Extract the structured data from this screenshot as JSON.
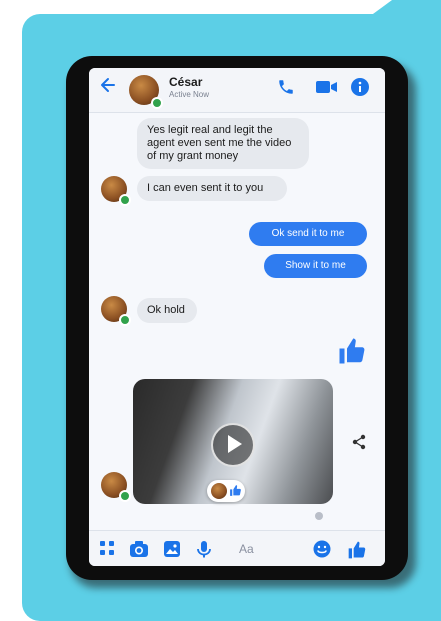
{
  "colors": {
    "accent": "#2f7cf0",
    "incoming_bubble": "#e6e9ee",
    "frame": "#5ccfe6",
    "online": "#31a24c"
  },
  "header": {
    "contact_name": "César",
    "status": "Active Now",
    "icons": [
      "back-arrow-icon",
      "phone-icon",
      "video-call-icon",
      "info-icon"
    ]
  },
  "messages": [
    {
      "from": "contact",
      "text": "Yes legit real and legit the agent even sent me the video of my grant money"
    },
    {
      "from": "contact",
      "text": "I can even sent it to you"
    },
    {
      "from": "me",
      "text": "Ok send it to me"
    },
    {
      "from": "me",
      "text": "Show it to me"
    },
    {
      "from": "contact",
      "text": "Ok hold"
    },
    {
      "from": "me",
      "type": "like",
      "icon": "thumbs-up-icon"
    },
    {
      "from": "contact",
      "type": "video",
      "icon": "play-icon"
    }
  ],
  "composer": {
    "placeholder": "Aa",
    "icons": [
      "menu-grid-icon",
      "camera-icon",
      "gallery-icon",
      "microphone-icon",
      "emoji-icon",
      "thumbs-up-icon"
    ]
  }
}
